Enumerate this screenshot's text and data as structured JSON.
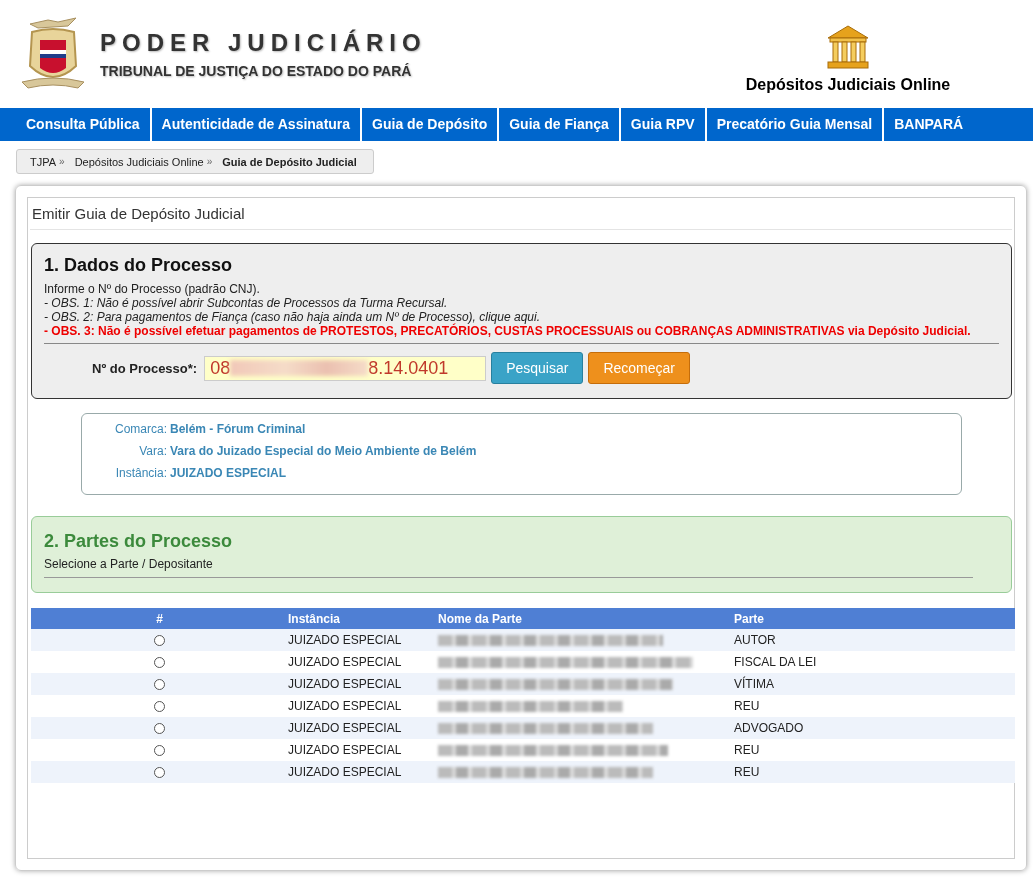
{
  "header": {
    "title": "PODER JUDICIÁRIO",
    "subtitle": "TRIBUNAL DE JUSTIÇA DO ESTADO DO PARÁ",
    "app_name": "Depósitos Judiciais Online"
  },
  "nav": [
    "Consulta Pública",
    "Autenticidade de Assinatura",
    "Guia de Depósito",
    "Guia de Fiança",
    "Guia RPV",
    "Precatório Guia Mensal",
    "BANPARÁ"
  ],
  "breadcrumb": [
    {
      "label": "TJPA",
      "sep": "»"
    },
    {
      "label": "Depósitos Judiciais Online",
      "sep": "»"
    },
    {
      "label": "Guia de Depósito Judicial"
    }
  ],
  "page_title": "Emitir Guia de Depósito Judicial",
  "section1": {
    "title": "1. Dados do Processo",
    "lines": [
      {
        "kind": "plain",
        "text": "Informe o Nº do Processo (padrão CNJ)."
      },
      {
        "kind": "note",
        "text": "- OBS. 1: Não é possível abrir Subcontas de Processos da Turma Recursal."
      },
      {
        "kind": "note",
        "text": "- OBS. 2: Para pagamentos de Fiança (caso não haja ainda um Nº de Processo), clique aqui."
      },
      {
        "kind": "warning",
        "text": "- OBS. 3: Não é possível efetuar pagamentos de PROTESTOS, PRECATÓRIOS, CUSTAS PROCESSUAIS ou COBRANÇAS ADMINISTRATIVAS via Depósito Judicial."
      }
    ],
    "field_label": "Nº do Processo*:",
    "field_value_start": "08",
    "field_value_end": "8.14.0401",
    "buttons": [
      {
        "kind": "primary",
        "label": "Pesquisar"
      },
      {
        "kind": "warning",
        "label": "Recomeçar"
      }
    ]
  },
  "info": [
    {
      "label": "Comarca:",
      "value": "Belém - Fórum Criminal"
    },
    {
      "label": "Vara:",
      "value": "Vara do Juizado Especial do Meio Ambiente de Belém"
    },
    {
      "label": "Instância:",
      "value": "JUIZADO ESPECIAL"
    }
  ],
  "section2": {
    "title": "2. Partes do Processo",
    "subtitle": "Selecione a Parte / Depositante"
  },
  "table": {
    "columns": [
      "#",
      "Instância",
      "Nome da Parte",
      "Parte"
    ],
    "rows": [
      {
        "selected": false,
        "instancia": "JUIZADO ESPECIAL",
        "parte": "AUTOR"
      },
      {
        "selected": false,
        "instancia": "JUIZADO ESPECIAL",
        "parte": "FISCAL DA LEI"
      },
      {
        "selected": false,
        "instancia": "JUIZADO ESPECIAL",
        "parte": "VÍTIMA"
      },
      {
        "selected": false,
        "instancia": "JUIZADO ESPECIAL",
        "parte": "REU"
      },
      {
        "selected": false,
        "instancia": "JUIZADO ESPECIAL",
        "parte": "ADVOGADO"
      },
      {
        "selected": false,
        "instancia": "JUIZADO ESPECIAL",
        "parte": "REU"
      },
      {
        "selected": false,
        "instancia": "JUIZADO ESPECIAL",
        "parte": "REU"
      }
    ]
  }
}
